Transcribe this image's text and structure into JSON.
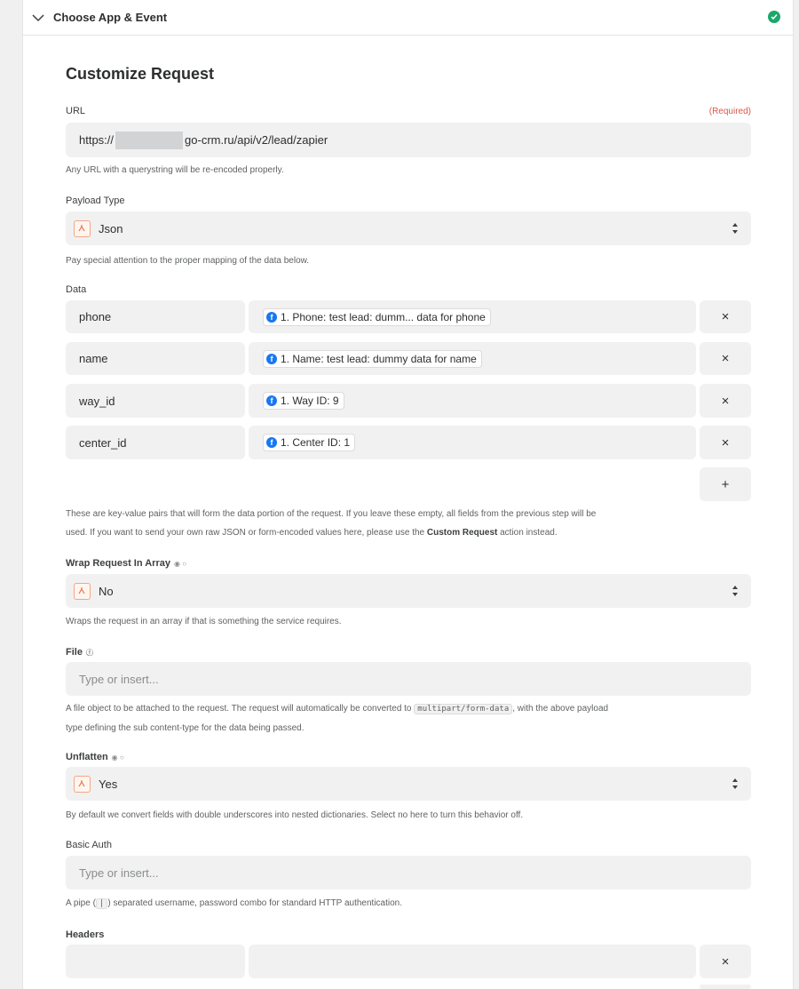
{
  "section": {
    "title": "Choose App & Event"
  },
  "form": {
    "heading": "Customize Request",
    "url": {
      "label": "URL",
      "required": "(Required)",
      "value_prefix": "https://",
      "value_suffix": "go-crm.ru/api/v2/lead/zapier",
      "help": "Any URL with a querystring will be re-encoded properly."
    },
    "payload_type": {
      "label": "Payload Type",
      "value": "Json",
      "help": "Pay special attention to the proper mapping of the data below."
    },
    "data": {
      "label": "Data",
      "rows": [
        {
          "key": "phone",
          "pill": "1. Phone: test lead: dumm... data for phone"
        },
        {
          "key": "name",
          "pill": "1. Name: test lead: dummy data for name"
        },
        {
          "key": "way_id",
          "pill": "1. Way ID: 9"
        },
        {
          "key": "center_id",
          "pill": "1. Center ID: 1"
        }
      ],
      "remove_label": "×",
      "add_label": "+",
      "help_1": "These are key-value pairs that will form the data portion of the request. If you leave these empty, all fields from the previous step will be",
      "help_2a": "used. If you want to send your own raw JSON or form-encoded values here, please use the ",
      "help_2b": "Custom Request",
      "help_2c": " action instead."
    },
    "wrap": {
      "label": "Wrap Request In Array",
      "value": "No",
      "help": "Wraps the request in an array if that is something the service requires."
    },
    "file": {
      "label": "File",
      "placeholder": "Type or insert...",
      "help_1a": "A file object to be attached to the request. The request will automatically be converted to ",
      "help_1code": "multipart/form-data",
      "help_1b": ", with the above payload",
      "help_2": "type defining the sub content-type for the data being passed."
    },
    "unflatten": {
      "label": "Unflatten",
      "value": "Yes",
      "help": "By default we convert fields with double underscores into nested dictionaries. Select no here to turn this behavior off."
    },
    "basic_auth": {
      "label": "Basic Auth",
      "placeholder": "Type or insert...",
      "help_a": "A pipe (",
      "help_code": "|",
      "help_b": ") separated username, password combo for standard HTTP authentication."
    },
    "headers": {
      "label": "Headers",
      "remove_label": "×"
    }
  }
}
